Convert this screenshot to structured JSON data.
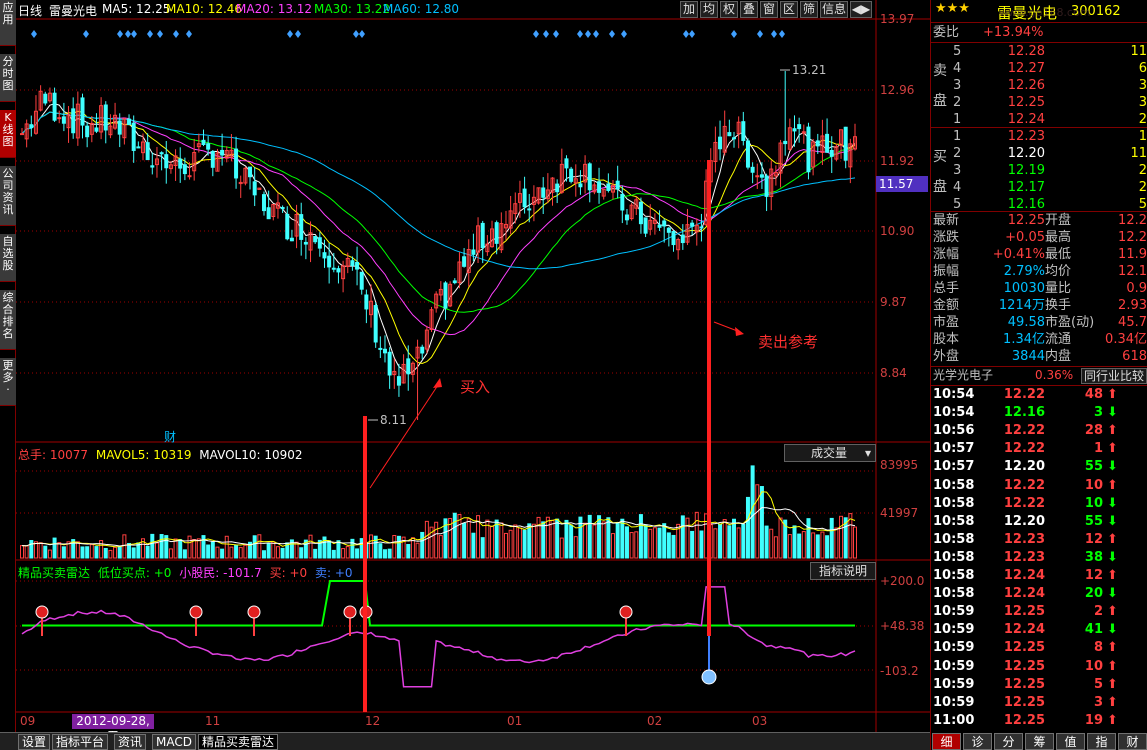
{
  "left_tabs": [
    {
      "label": "应\n用"
    },
    {
      "label": "分\n时\n图"
    },
    {
      "label": "K\n线\n图"
    },
    {
      "label": "公\n司\n资\n讯"
    },
    {
      "label": "自\n选\n股"
    },
    {
      "label": "综\n合\n排\n名"
    },
    {
      "label": "更\n多\n·"
    }
  ],
  "header": {
    "period": "日线",
    "stock": "雷曼光电",
    "ma5": "MA5: 12.25",
    "ma10": "MA10: 12.46",
    "ma20": "MA20: 13.12",
    "ma30": "MA30: 13.22",
    "ma60": "MA60: 12.80"
  },
  "toolbar": [
    "加",
    "均",
    "权",
    "叠",
    "窗",
    "区",
    "筛",
    "信息",
    "◀▶"
  ],
  "colors": {
    "ma5": "#ffffff",
    "ma10": "#ffff00",
    "ma20": "#ff40ff",
    "ma30": "#00ff00",
    "ma60": "#00c0ff",
    "up": "#ff4040",
    "down": "#40ffff",
    "axis": "#a00000"
  },
  "price_axis": [
    "13.97",
    "12.96",
    "11.92",
    "10.90",
    "9.87",
    "8.84"
  ],
  "price_current": "11.57",
  "high_label": "13.21",
  "low_label": "8.11",
  "fin_marker": "财",
  "buy_label": "买入",
  "sell_label": "卖出参考",
  "volume": {
    "title": "总手: 10077",
    "mavol5": "MAVOL5: 10319",
    "mavol10": "MAVOL10: 10902",
    "dropdown": "成交量",
    "axis": [
      "83995",
      "41997"
    ]
  },
  "indicator": {
    "name": "精品买卖雷达",
    "low_buy": "低位买点: +0",
    "small": "小股民: -101.7",
    "buy": "买: +0",
    "sell": "卖: +0",
    "button": "指标说明",
    "axis": [
      "+200.0",
      "+48.38",
      "-103.2"
    ]
  },
  "date_axis": [
    "09",
    "11",
    "12",
    "01",
    "02",
    "03"
  ],
  "date_highlight": "2012-09-28,五",
  "bottom_tabs": [
    "设置",
    "指标平台",
    "资讯",
    "MACD",
    "精品买卖雷达"
  ],
  "quote": {
    "title": "雷曼光电",
    "code": "300162",
    "watermark": "www.gp168.com",
    "weibi_label": "委比",
    "weibi_value": "+13.94%",
    "sell": [
      {
        "lvl": "5",
        "price": "12.28",
        "vol": "11"
      },
      {
        "lvl": "4",
        "price": "12.27",
        "vol": "6"
      },
      {
        "lvl": "3",
        "price": "12.26",
        "vol": "3"
      },
      {
        "lvl": "2",
        "price": "12.25",
        "vol": "3"
      },
      {
        "lvl": "1",
        "price": "12.24",
        "vol": "2"
      }
    ],
    "buy": [
      {
        "lvl": "1",
        "price": "12.23",
        "vol": "1"
      },
      {
        "lvl": "2",
        "price": "12.20",
        "vol": "11"
      },
      {
        "lvl": "3",
        "price": "12.19",
        "vol": "2"
      },
      {
        "lvl": "4",
        "price": "12.17",
        "vol": "2"
      },
      {
        "lvl": "5",
        "price": "12.16",
        "vol": "5"
      }
    ],
    "sell_side": "卖\n盘",
    "buy_side": "买\n盘",
    "stats": [
      {
        "k1": "最新",
        "v1": "12.25",
        "k2": "开盘",
        "v2": "12.2"
      },
      {
        "k1": "涨跌",
        "v1": "+0.05",
        "k2": "最高",
        "v2": "12.2"
      },
      {
        "k1": "涨幅",
        "v1": "+0.41%",
        "k2": "最低",
        "v2": "11.9"
      },
      {
        "k1": "振幅",
        "v1": "2.79%",
        "k2": "均价",
        "v2": "12.1"
      },
      {
        "k1": "总手",
        "v1": "10030",
        "k2": "量比",
        "v2": "0.9"
      },
      {
        "k1": "金额",
        "v1": "1214万",
        "k2": "换手",
        "v2": "2.93"
      },
      {
        "k1": "市盈",
        "v1": "49.58",
        "k2": "市盈(动)",
        "v2": "45.7"
      },
      {
        "k1": "股本",
        "v1": "1.34亿",
        "k2": "流通",
        "v2": "0.34亿"
      },
      {
        "k1": "外盘",
        "v1": "3844",
        "k2": "内盘",
        "v2": "618"
      }
    ],
    "sector": "光学光电子",
    "sector_pct": "0.36%",
    "compare": "同行业比较",
    "ticks": [
      {
        "t": "10:54",
        "p": "12.22",
        "v": "48",
        "d": "up"
      },
      {
        "t": "10:54",
        "p": "12.16",
        "v": "3",
        "d": "down"
      },
      {
        "t": "10:56",
        "p": "12.22",
        "v": "28",
        "d": "up"
      },
      {
        "t": "10:57",
        "p": "12.22",
        "v": "1",
        "d": "up"
      },
      {
        "t": "10:57",
        "p": "12.20",
        "v": "55",
        "d": "down"
      },
      {
        "t": "10:58",
        "p": "12.22",
        "v": "10",
        "d": "up"
      },
      {
        "t": "10:58",
        "p": "12.22",
        "v": "10",
        "d": "down"
      },
      {
        "t": "10:58",
        "p": "12.20",
        "v": "55",
        "d": "down"
      },
      {
        "t": "10:58",
        "p": "12.23",
        "v": "12",
        "d": "up"
      },
      {
        "t": "10:58",
        "p": "12.23",
        "v": "38",
        "d": "down"
      },
      {
        "t": "10:58",
        "p": "12.24",
        "v": "12",
        "d": "up"
      },
      {
        "t": "10:58",
        "p": "12.24",
        "v": "20",
        "d": "down"
      },
      {
        "t": "10:59",
        "p": "12.25",
        "v": "2",
        "d": "up"
      },
      {
        "t": "10:59",
        "p": "12.24",
        "v": "41",
        "d": "down"
      },
      {
        "t": "10:59",
        "p": "12.25",
        "v": "8",
        "d": "up"
      },
      {
        "t": "10:59",
        "p": "12.25",
        "v": "10",
        "d": "up"
      },
      {
        "t": "10:59",
        "p": "12.25",
        "v": "5",
        "d": "up"
      },
      {
        "t": "10:59",
        "p": "12.25",
        "v": "3",
        "d": "up"
      },
      {
        "t": "11:00",
        "p": "12.25",
        "v": "19",
        "d": "up"
      }
    ],
    "right_tabs": [
      "细",
      "诊",
      "分",
      "筹",
      "值",
      "指",
      "财"
    ]
  },
  "chart_data": {
    "type": "candlestick",
    "price_range": [
      8.11,
      13.97
    ],
    "high": 13.21,
    "low": 8.11,
    "close_trend": [
      12.3,
      12.8,
      12.6,
      12.4,
      12.5,
      12.2,
      12.0,
      11.8,
      11.9,
      12.1,
      11.6,
      11.3,
      11.0,
      10.9,
      10.6,
      10.3,
      9.6,
      8.6,
      8.9,
      9.8,
      10.3,
      10.8,
      11.0,
      11.3,
      11.6,
      11.8,
      11.7,
      11.3,
      11.1,
      10.9,
      10.7,
      11.1,
      12.5,
      12.1,
      11.5,
      12.6,
      11.9,
      12.2,
      12.0
    ],
    "volume_range": [
      0,
      83995
    ],
    "indicator_range": [
      -103.2,
      200.0
    ],
    "indicator_level": 48.38
  }
}
